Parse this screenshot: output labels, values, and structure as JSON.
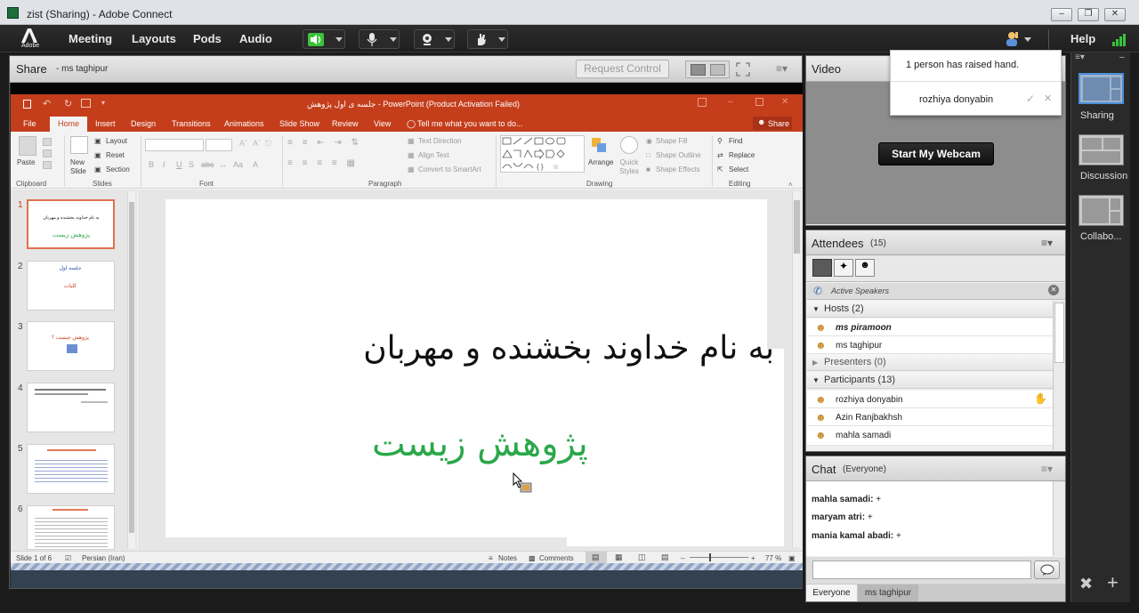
{
  "window": {
    "title": "zist (Sharing) - Adobe Connect"
  },
  "menubar": {
    "items": [
      "Meeting",
      "Layouts",
      "Pods",
      "Audio"
    ],
    "help": "Help",
    "logo_text": "Adobe"
  },
  "share_pod": {
    "title": "Share",
    "presenter": "- ms taghipur",
    "request_control": "Request Control"
  },
  "powerpoint": {
    "title": "جلسه ی اول پژوهش - PowerPoint (Product Activation Failed)",
    "tabs": [
      "File",
      "Home",
      "Insert",
      "Design",
      "Transitions",
      "Animations",
      "Slide Show",
      "Review",
      "View"
    ],
    "tell_me": "Tell me what you want to do...",
    "share": "Share",
    "ribbon": {
      "clipboard": {
        "paste": "Paste",
        "group": "Clipboard"
      },
      "slides": {
        "new_slide": "New Slide",
        "layout": "Layout",
        "reset": "Reset",
        "section": "Section",
        "group": "Slides"
      },
      "font": {
        "group": "Font"
      },
      "paragraph": {
        "text_direction": "Text Direction",
        "align_text": "Align Text",
        "convert": "Convert to SmartArt",
        "group": "Paragraph"
      },
      "drawing": {
        "arrange": "Arrange",
        "quick_styles": "Quick Styles",
        "shape_fill": "Shape Fill",
        "shape_outline": "Shape Outline",
        "shape_effects": "Shape Effects",
        "group": "Drawing"
      },
      "editing": {
        "find": "Find",
        "replace": "Replace",
        "select": "Select",
        "group": "Editing"
      }
    },
    "thumbnails": [
      {
        "num": "1",
        "line1": "به نام خداوند بخشنده و مهربان",
        "line2": "پژوهش زیست"
      },
      {
        "num": "2",
        "line1": "جلسه اول",
        "line2": "کلیات"
      },
      {
        "num": "3",
        "line1": "پژوهش چیست ؟",
        "line2": ""
      },
      {
        "num": "4",
        "line1": "",
        "line2": ""
      },
      {
        "num": "5",
        "line1": "",
        "line2": ""
      },
      {
        "num": "6",
        "line1": "",
        "line2": ""
      }
    ],
    "slide": {
      "title": "به نام خداوند بخشنده و مهربان",
      "subtitle": "پژوهش زیست"
    },
    "status": {
      "slide_of": "Slide 1 of 6",
      "language": "Persian (Iran)",
      "notes": "Notes",
      "comments": "Comments",
      "zoom": "77 %"
    }
  },
  "video_pod": {
    "title": "Video",
    "start_webcam": "Start My Webcam"
  },
  "raised_hand_popup": {
    "message": "1 person has raised hand.",
    "user": "rozhiya donyabin"
  },
  "attendees_pod": {
    "title": "Attendees",
    "count": "(15)",
    "active_speakers": "Active Speakers",
    "hosts": {
      "label": "Hosts (2)",
      "members": [
        "ms piramoon",
        "ms taghipur"
      ]
    },
    "presenters": {
      "label": "Presenters (0)"
    },
    "participants": {
      "label": "Participants (13)",
      "members": [
        "rozhiya donyabin",
        "Azin Ranjbakhsh",
        "mahla samadi"
      ]
    }
  },
  "chat_pod": {
    "title": "Chat",
    "scope": "(Everyone)",
    "messages": [
      {
        "user": "mahla samadi:",
        "text": "+"
      },
      {
        "user": "maryam atri:",
        "text": "+"
      },
      {
        "user": "mania kamal abadi:",
        "text": "+"
      }
    ],
    "tabs": [
      "Everyone",
      "ms taghipur"
    ]
  },
  "layouts_panel": {
    "items": [
      "Sharing",
      "Discussion",
      "Collabo..."
    ]
  },
  "colors": {
    "ppt_accent": "#c43e1c",
    "slide_subtitle": "#2aa84a",
    "mic_green": "#3bc23b"
  }
}
